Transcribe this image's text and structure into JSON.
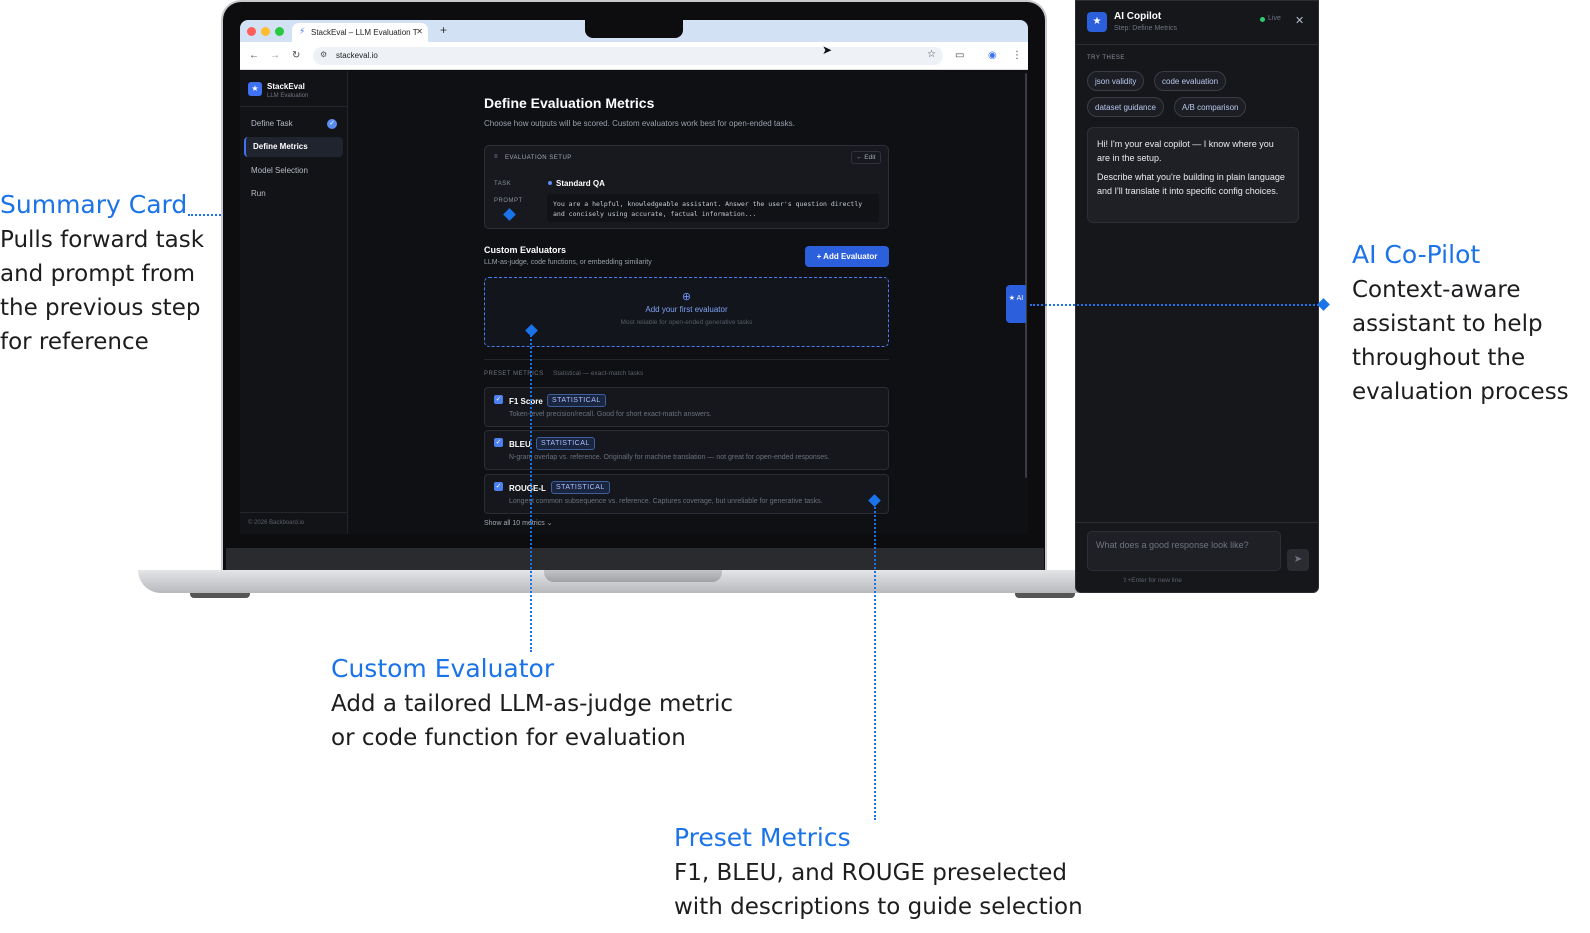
{
  "annotations": {
    "summary_card": {
      "title": "Summary Card",
      "lines": [
        "Pulls forward task",
        "and prompt from",
        "the previous step",
        "for reference"
      ]
    },
    "ai_copilot": {
      "title": "AI Co-Pilot",
      "lines": [
        "Context-aware",
        "assistant to help",
        "throughout the",
        "evaluation process"
      ]
    },
    "custom_evaluator": {
      "title": "Custom Evaluator",
      "lines": [
        "Add a tailored LLM-as-judge metric",
        "or code function for evaluation"
      ]
    },
    "preset_metrics": {
      "title": "Preset Metrics",
      "lines": [
        "F1, BLEU, and ROUGE preselected",
        "with descriptions to guide selection"
      ]
    }
  },
  "browser": {
    "tab_title": "StackEval – LLM Evaluation T",
    "url": "stackeval.io"
  },
  "app": {
    "name": "StackEval",
    "subtitle": "LLM Evaluation",
    "nav": [
      {
        "label": "Define Task",
        "completed": true
      },
      {
        "label": "Define Metrics",
        "active": true
      },
      {
        "label": "Model Selection"
      },
      {
        "label": "Run"
      }
    ],
    "footer": "© 2026 Backboard.io"
  },
  "page": {
    "title": "Define Evaluation Metrics",
    "subtitle": "Choose how outputs will be scored. Custom evaluators work best for open-ended tasks.",
    "setup": {
      "heading": "EVALUATION SETUP",
      "edit_label": "← Edit",
      "task_label": "TASK",
      "task_value": "Standard QA",
      "prompt_label": "PROMPT",
      "prompt_value": "You are a helpful, knowledgeable assistant. Answer the user's question directly and concisely using accurate, factual information..."
    },
    "custom": {
      "title": "Custom Evaluators",
      "subtitle": "LLM-as-judge, code functions, or embedding similarity",
      "add_button": "+ Add Evaluator",
      "empty_title": "Add your first evaluator",
      "empty_sub": "Most reliable for open-ended generative tasks"
    },
    "preset": {
      "label": "PRESET METRICS",
      "sublabel": "Statistical — exact-match tasks",
      "metrics": [
        {
          "name": "F1 Score",
          "badge": "STATISTICAL",
          "desc": "Token-level precision/recall. Good for short exact-match answers.",
          "checked": true
        },
        {
          "name": "BLEU",
          "badge": "STATISTICAL",
          "desc": "N-gram overlap vs. reference. Originally for machine translation — not great for open-ended responses.",
          "checked": true
        },
        {
          "name": "ROUGE-L",
          "badge": "STATISTICAL",
          "desc": "Longest common subsequence vs. reference. Captures coverage, but unreliable for generative tasks.",
          "checked": true
        }
      ],
      "show_all": "Show all 10 metrics ⌄"
    },
    "ai_tab": "★ AI"
  },
  "copilot": {
    "title": "AI Copilot",
    "step": "Step: Define Metrics",
    "status": "Live",
    "try_label": "TRY THESE",
    "chips": [
      "json validity",
      "code evaluation",
      "dataset guidance",
      "A/B comparison"
    ],
    "message_p1": "Hi! I'm your eval copilot — I know where you are in the setup.",
    "message_p2": "Describe what you're building in plain language and I'll translate it into specific config choices.",
    "input_placeholder": "What does a good response look like?",
    "hint": "⇧+Enter for new line"
  },
  "colors": {
    "accent": "#1a73e8",
    "app_primary": "#2b5fdc",
    "app_bg": "#0f1014"
  }
}
